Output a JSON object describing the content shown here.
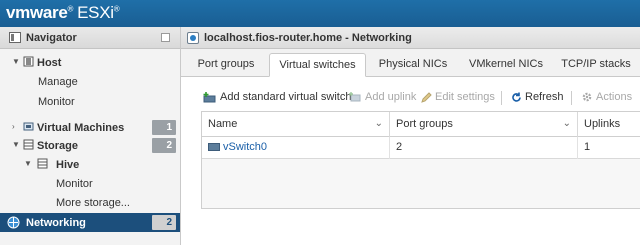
{
  "brand": {
    "vm": "vmware",
    "product": "ESXi",
    "symbol": "®"
  },
  "navigator": {
    "title": "Navigator",
    "items": [
      {
        "label": "Host",
        "expanded": true
      },
      {
        "label": "Manage"
      },
      {
        "label": "Monitor"
      },
      {
        "label": "Virtual Machines",
        "count": "1"
      },
      {
        "label": "Storage",
        "count": "2",
        "expanded": true
      },
      {
        "label": "Hive",
        "expanded": true
      },
      {
        "label": "Monitor"
      },
      {
        "label": "More storage..."
      },
      {
        "label": "Networking",
        "count": "2",
        "selected": true
      }
    ]
  },
  "main": {
    "title": "localhost.fios-router.home - Networking",
    "tabs": [
      {
        "label": "Port groups"
      },
      {
        "label": "Virtual switches",
        "active": true
      },
      {
        "label": "Physical NICs"
      },
      {
        "label": "VMkernel NICs"
      },
      {
        "label": "TCP/IP stacks"
      }
    ],
    "toolbar": {
      "add_switch": "Add standard virtual switch",
      "add_uplink": "Add uplink",
      "edit_settings": "Edit settings",
      "refresh": "Refresh",
      "actions": "Actions"
    },
    "table": {
      "columns": [
        "Name",
        "Port groups",
        "Uplinks"
      ],
      "rows": [
        {
          "name": "vSwitch0",
          "port_groups": "2",
          "uplinks": "1"
        }
      ]
    }
  },
  "colors": {
    "topbar": "#1f6fa8",
    "selected": "#1c4f7c",
    "link": "#1a5fa8"
  }
}
